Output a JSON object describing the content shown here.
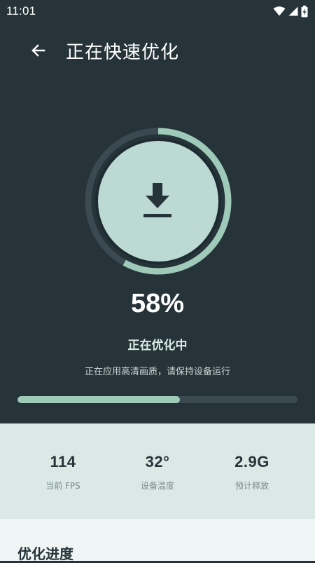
{
  "status_bar": {
    "time": "11:01",
    "icons": [
      "wifi-icon",
      "cellular-signal-icon",
      "battery-charging-icon"
    ]
  },
  "header": {
    "back_icon": "arrow-left-icon",
    "title": "正在快速优化"
  },
  "progress": {
    "percent_label": "58%",
    "fraction": 0.58,
    "center_icon": "download-icon",
    "status_title": "正在优化中",
    "status_subtitle": "正在应用高清画质，请保持设备运行"
  },
  "stats": [
    {
      "value": "114",
      "label": "当前 FPS"
    },
    {
      "value": "32°",
      "label": "设备温度"
    },
    {
      "value": "2.9G",
      "label": "预计释放"
    }
  ],
  "section": {
    "title": "优化进度"
  },
  "colors": {
    "background": "#26343a",
    "accent": "#9fcab9",
    "ring_track": "#3a4a50",
    "circle_fill": "#bcd9d3",
    "stats_panel": "#dbe9e6",
    "bottom_panel": "#eef5f4"
  }
}
